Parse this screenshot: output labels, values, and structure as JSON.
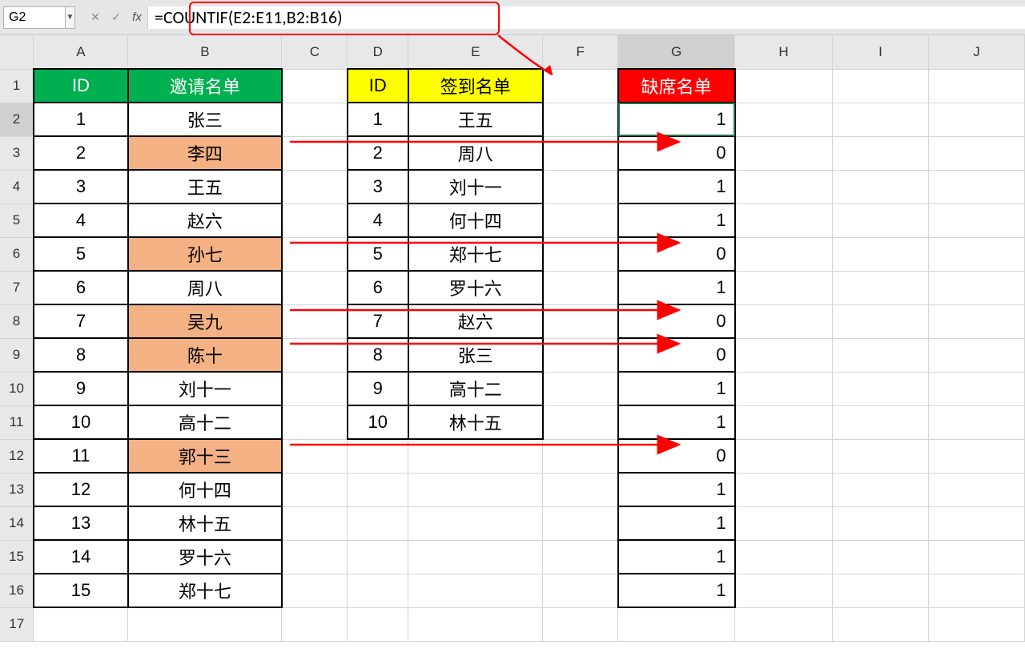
{
  "namebox": "G2",
  "formula": "=COUNTIF(E2:E11,B2:B16)",
  "fx_label": "fx",
  "cols": [
    "A",
    "B",
    "C",
    "D",
    "E",
    "F",
    "G",
    "H",
    "I",
    "J"
  ],
  "rows": [
    "1",
    "2",
    "3",
    "4",
    "5",
    "6",
    "7",
    "8",
    "9",
    "10",
    "11",
    "12",
    "13",
    "14",
    "15",
    "16",
    "17"
  ],
  "hdr": {
    "A": "ID",
    "B": "邀请名单",
    "D": "ID",
    "E": "签到名单",
    "G": "缺席名单"
  },
  "invite": [
    {
      "id": "1",
      "name": "张三",
      "hl": false
    },
    {
      "id": "2",
      "name": "李四",
      "hl": true
    },
    {
      "id": "3",
      "name": "王五",
      "hl": false
    },
    {
      "id": "4",
      "name": "赵六",
      "hl": false
    },
    {
      "id": "5",
      "name": "孙七",
      "hl": true
    },
    {
      "id": "6",
      "name": "周八",
      "hl": false
    },
    {
      "id": "7",
      "name": "吴九",
      "hl": true
    },
    {
      "id": "8",
      "name": "陈十",
      "hl": true
    },
    {
      "id": "9",
      "name": "刘十一",
      "hl": false
    },
    {
      "id": "10",
      "name": "高十二",
      "hl": false
    },
    {
      "id": "11",
      "name": "郭十三",
      "hl": true
    },
    {
      "id": "12",
      "name": "何十四",
      "hl": false
    },
    {
      "id": "13",
      "name": "林十五",
      "hl": false
    },
    {
      "id": "14",
      "name": "罗十六",
      "hl": false
    },
    {
      "id": "15",
      "name": "郑十七",
      "hl": false
    }
  ],
  "signin": [
    {
      "id": "1",
      "name": "王五"
    },
    {
      "id": "2",
      "name": "周八"
    },
    {
      "id": "3",
      "name": "刘十一"
    },
    {
      "id": "4",
      "name": "何十四"
    },
    {
      "id": "5",
      "name": "郑十七"
    },
    {
      "id": "6",
      "name": "罗十六"
    },
    {
      "id": "7",
      "name": "赵六"
    },
    {
      "id": "8",
      "name": "张三"
    },
    {
      "id": "9",
      "name": "高十二"
    },
    {
      "id": "10",
      "name": "林十五"
    }
  ],
  "absent": [
    "1",
    "0",
    "1",
    "1",
    "0",
    "1",
    "0",
    "0",
    "1",
    "1",
    "0",
    "1",
    "1",
    "1",
    "1"
  ],
  "col_widths": {
    "corner": 42,
    "A": 118,
    "B": 192,
    "C": 82,
    "D": 76,
    "E": 168,
    "F": 94,
    "G": 146,
    "H": 122,
    "I": 120,
    "J": 120
  },
  "arrows": [
    {
      "from_row": 3,
      "label": "0"
    },
    {
      "from_row": 6,
      "label": "0"
    },
    {
      "from_row": 8,
      "label": "0"
    },
    {
      "from_row": 9,
      "label": "0"
    },
    {
      "from_row": 12,
      "label": "0"
    }
  ]
}
